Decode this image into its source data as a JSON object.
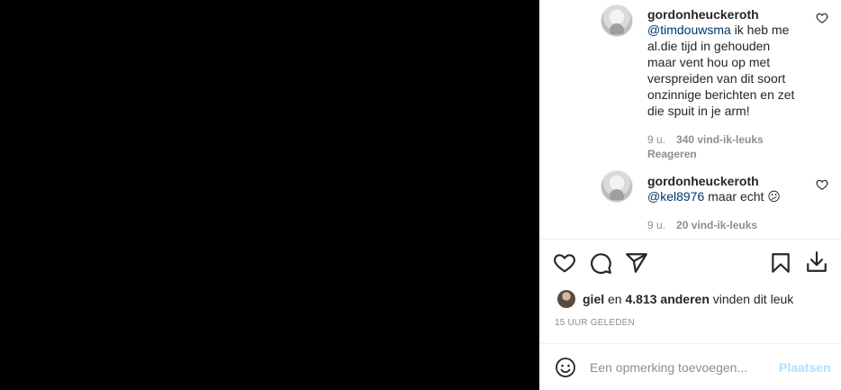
{
  "comments": [
    {
      "username": "gordonheuckeroth",
      "mention": "@timdouwsma",
      "text": " ik heb me al.die tijd in gehouden maar vent hou op met verspreiden van dit soort onzinnige berichten en zet die spuit in je arm!",
      "time": "9 u.",
      "likes": "340 vind-ik-leuks",
      "reply_label": "Reageren"
    },
    {
      "username": "gordonheuckeroth",
      "mention": "@kel8976",
      "text": " maar echt 😕",
      "time": "9 u.",
      "likes": "20 vind-ik-leuks"
    }
  ],
  "likes": {
    "first_liker": "giel",
    "connector": " en ",
    "others": "4.813 anderen",
    "suffix": " vinden dit leuk"
  },
  "posted_ago": "15 UUR GELEDEN",
  "comment_box": {
    "placeholder": "Een opmerking toevoegen...",
    "post_label": "Plaatsen"
  },
  "icons": [
    "heart-icon",
    "comment-icon",
    "share-icon",
    "bookmark-icon",
    "download-icon",
    "emoji-icon"
  ]
}
